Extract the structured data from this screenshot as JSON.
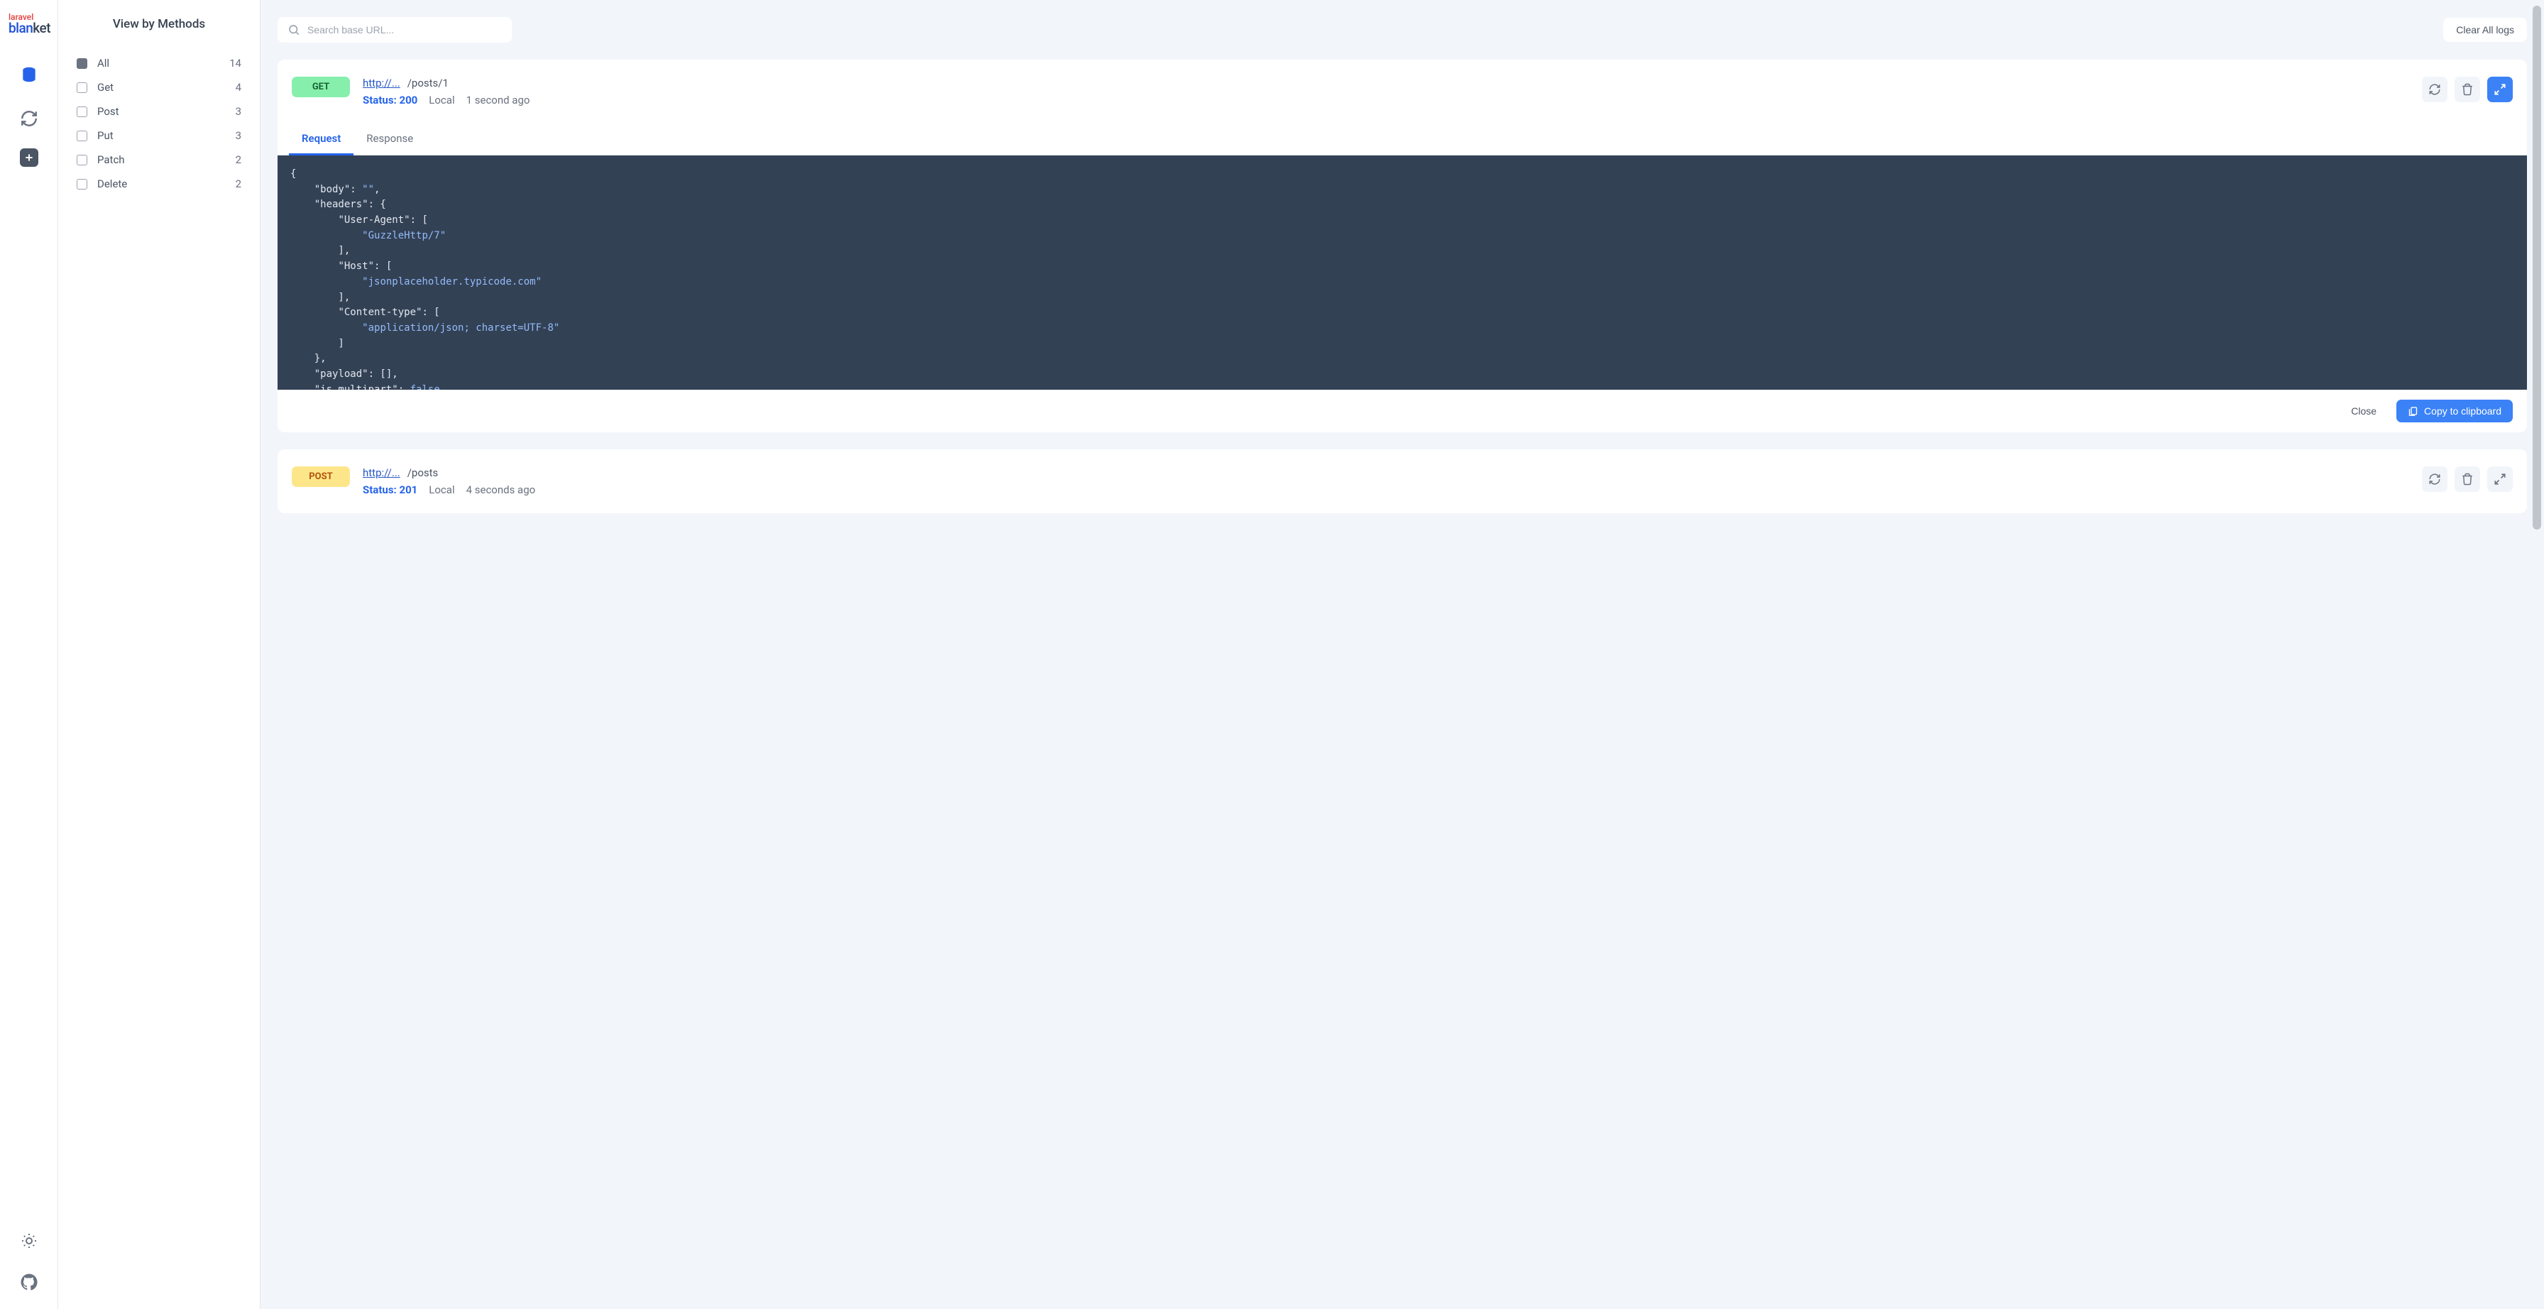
{
  "logo": {
    "top": "laravel",
    "b1": "blan",
    "b2": "ket"
  },
  "sidebar": {
    "title": "View by Methods",
    "filters": [
      {
        "label": "All",
        "count": "14",
        "selected": true
      },
      {
        "label": "Get",
        "count": "4",
        "selected": false
      },
      {
        "label": "Post",
        "count": "3",
        "selected": false
      },
      {
        "label": "Put",
        "count": "3",
        "selected": false
      },
      {
        "label": "Patch",
        "count": "2",
        "selected": false
      },
      {
        "label": "Delete",
        "count": "2",
        "selected": false
      }
    ]
  },
  "search": {
    "placeholder": "Search base URL..."
  },
  "clear_logs_label": "Clear All logs",
  "tabs": {
    "request": "Request",
    "response": "Response"
  },
  "actions": {
    "close": "Close",
    "copy": "Copy to clipboard"
  },
  "logs": [
    {
      "method": "GET",
      "method_class": "method-get",
      "host": "http://...",
      "path": "/posts/1",
      "status_label": "Status: 200",
      "origin": "Local",
      "age": "1 second ago",
      "expanded": true,
      "active_tab": "request",
      "code_lines": [
        [
          "{"
        ],
        [
          "    ",
          [
            "key",
            "\"body\""
          ],
          ": ",
          [
            "str",
            "\"\""
          ],
          ","
        ],
        [
          "    ",
          [
            "key",
            "\"headers\""
          ],
          ": {"
        ],
        [
          "        ",
          [
            "key",
            "\"User-Agent\""
          ],
          ": ["
        ],
        [
          "            ",
          [
            "str",
            "\"GuzzleHttp/7\""
          ]
        ],
        [
          "        ],"
        ],
        [
          "        ",
          [
            "key",
            "\"Host\""
          ],
          ": ["
        ],
        [
          "            ",
          [
            "str",
            "\"jsonplaceholder.typicode.com\""
          ]
        ],
        [
          "        ],"
        ],
        [
          "        ",
          [
            "key",
            "\"Content-type\""
          ],
          ": ["
        ],
        [
          "            ",
          [
            "str",
            "\"application/json; charset=UTF-8\""
          ]
        ],
        [
          "        ]"
        ],
        [
          "    },"
        ],
        [
          "    ",
          [
            "key",
            "\"payload\""
          ],
          ": [],"
        ],
        [
          "    ",
          [
            "key",
            "\"is_multipart\""
          ],
          ": ",
          [
            "kw",
            "false"
          ]
        ]
      ]
    },
    {
      "method": "POST",
      "method_class": "method-post",
      "host": "http://...",
      "path": "/posts",
      "status_label": "Status: 201",
      "origin": "Local",
      "age": "4 seconds ago",
      "expanded": false
    }
  ]
}
